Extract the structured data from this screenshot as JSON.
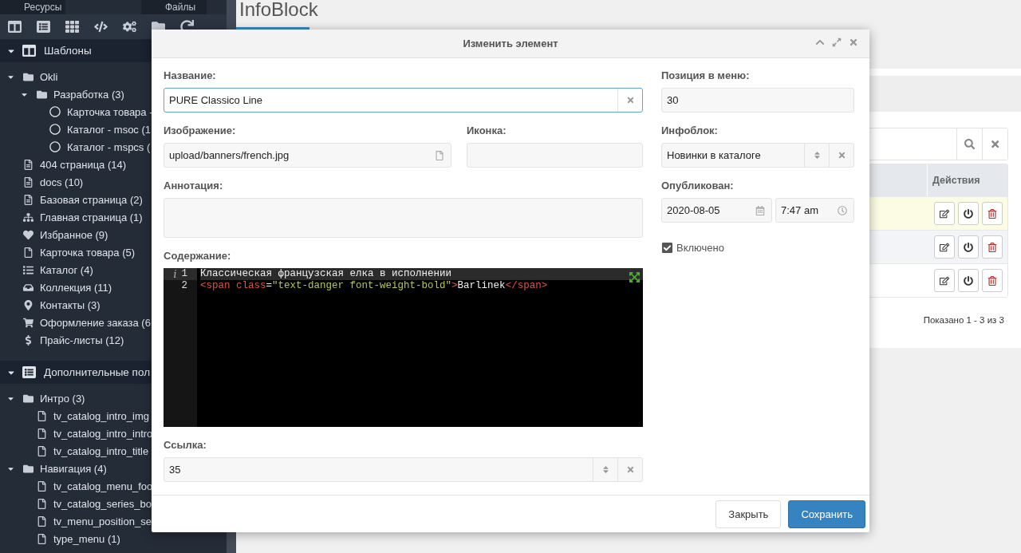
{
  "sidebar": {
    "tabs": [
      {
        "label": "Ресурсы",
        "selected": false
      },
      {
        "label": "Файлы",
        "selected": false
      }
    ],
    "sections": [
      {
        "title": "Шаблоны",
        "kind": "templates",
        "expanded": true,
        "items": [
          {
            "label": "Okli",
            "kind": "folder",
            "expanded": true,
            "children": [
              {
                "label": "Разработка (3)",
                "kind": "folder",
                "expanded": true,
                "children": [
                  {
                    "label": "Карточка товара -",
                    "kind": "circle"
                  },
                  {
                    "label": "Каталог - msoc (1",
                    "kind": "circle"
                  },
                  {
                    "label": "Каталог - mspcs (",
                    "kind": "circle"
                  }
                ]
              }
            ]
          },
          {
            "label": "404 страница (14)",
            "kind": "file-text"
          },
          {
            "label": "docs (10)",
            "kind": "file-text"
          },
          {
            "label": "Базовая страница (2)",
            "kind": "file-text"
          },
          {
            "label": "Главная страница (1)",
            "kind": "sitemap"
          },
          {
            "label": "Избранное (9)",
            "kind": "heart"
          },
          {
            "label": "Карточка товара (5)",
            "kind": "file"
          },
          {
            "label": "Каталог (4)",
            "kind": "list"
          },
          {
            "label": "Коллекция (11)",
            "kind": "inbox"
          },
          {
            "label": "Контакты (3)",
            "kind": "marker"
          },
          {
            "label": "Оформление заказа (6",
            "kind": "cart"
          },
          {
            "label": "Прайс-листы (12)",
            "kind": "dollar"
          }
        ]
      },
      {
        "title": "Дополнительные пол",
        "kind": "fields",
        "expanded": true,
        "items": [
          {
            "label": "Интро (3)",
            "kind": "folder",
            "expanded": true,
            "children": [
              {
                "label": "tv_catalog_intro_img",
                "kind": "file"
              },
              {
                "label": "tv_catalog_intro_intro",
                "kind": "file"
              },
              {
                "label": "tv_catalog_intro_title",
                "kind": "file"
              }
            ]
          },
          {
            "label": "Навигация (4)",
            "kind": "folder",
            "expanded": true,
            "children": [
              {
                "label": "tv_catalog_menu_foo",
                "kind": "file"
              },
              {
                "label": "tv_catalog_series_bo",
                "kind": "file"
              },
              {
                "label": "tv_menu_position_se",
                "kind": "file"
              },
              {
                "label": "type_menu (1)",
                "kind": "file"
              }
            ]
          }
        ]
      }
    ]
  },
  "page": {
    "title": "InfoBlock",
    "table": {
      "columns": [
        "Действия"
      ],
      "rows": [
        {
          "selected": true
        },
        {
          "selected": false
        },
        {
          "selected": false
        }
      ],
      "footer": "Показано 1 - 3 из 3"
    }
  },
  "modal": {
    "title": "Изменить элемент",
    "name": {
      "label": "Название:",
      "value": "PURE Classico Line",
      "focused": true
    },
    "image": {
      "label": "Изображение:",
      "value": "upload/banners/french.jpg"
    },
    "icon": {
      "label": "Иконка:"
    },
    "annotation": {
      "label": "Аннотация:"
    },
    "content": {
      "label": "Содержание:",
      "lines": [
        {
          "number": "1",
          "marker": "i",
          "active": true,
          "tokens": [
            {
              "kind": "text",
              "text": "Классическая французская елка в исполнении"
            }
          ]
        },
        {
          "number": "2",
          "active": false,
          "tokens": [
            {
              "kind": "tag",
              "text": "<span"
            },
            {
              "kind": "attr",
              "text": " class"
            },
            {
              "kind": "text",
              "text": "="
            },
            {
              "kind": "string",
              "text": "\"text-danger font-weight-bold\""
            },
            {
              "kind": "tag",
              "text": ">"
            },
            {
              "kind": "text",
              "text": "Barlinek"
            },
            {
              "kind": "tag",
              "text": "</span>"
            }
          ]
        }
      ]
    },
    "link": {
      "label": "Ссылка:",
      "value": "35"
    },
    "menu_position": {
      "label": "Позиция в меню:",
      "value": "30"
    },
    "infoblock": {
      "label": "Инфоблок:",
      "value": "Новинки в каталоге"
    },
    "published": {
      "label": "Опубликован:",
      "date": "2020-08-05",
      "time": "7:47 am"
    },
    "enabled": {
      "label": "Включено",
      "checked": true
    },
    "buttons": [
      {
        "label": "Закрыть",
        "kind": "default"
      },
      {
        "label": "Сохранить",
        "kind": "primary"
      }
    ]
  }
}
